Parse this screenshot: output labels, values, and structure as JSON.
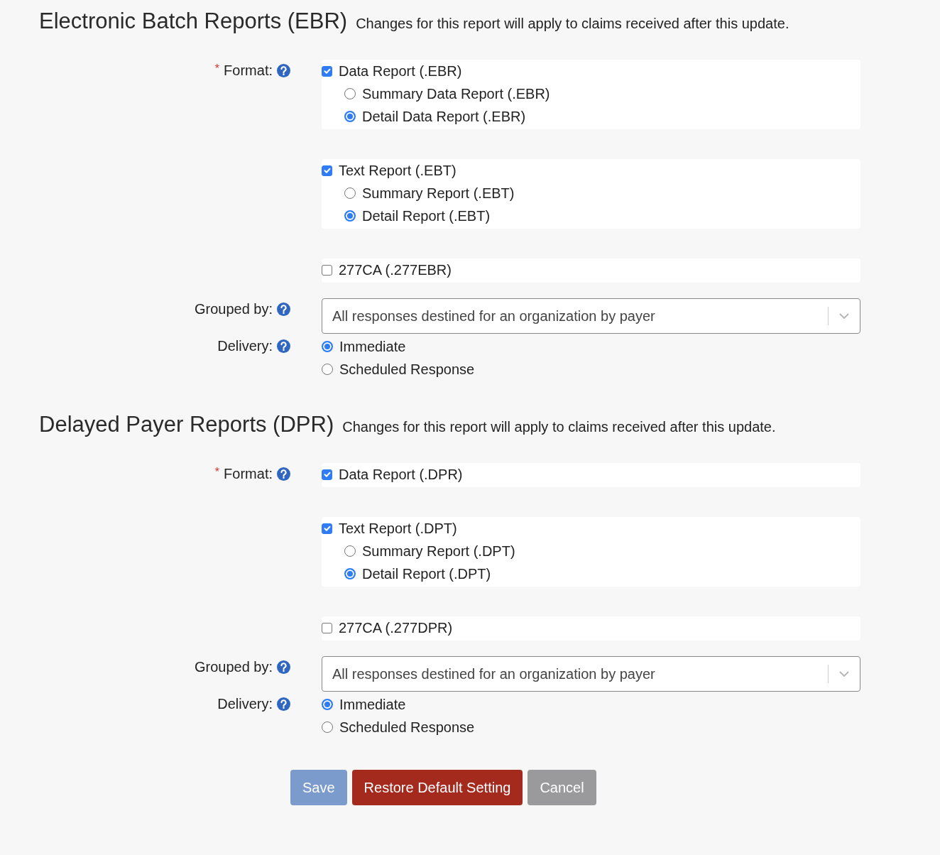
{
  "sections": [
    {
      "title": "Electronic Batch Reports (EBR)",
      "note": "Changes for this report will apply to claims received after this update.",
      "format": {
        "label": "Format:",
        "required_marker": "*",
        "options": [
          {
            "label": "Data Report (.EBR)",
            "checked": true,
            "suboptions": [
              {
                "label": "Summary Data Report (.EBR)",
                "selected": false
              },
              {
                "label": "Detail Data Report (.EBR)",
                "selected": true
              }
            ]
          },
          {
            "label": "Text Report (.EBT)",
            "checked": true,
            "suboptions": [
              {
                "label": "Summary Report (.EBT)",
                "selected": false
              },
              {
                "label": "Detail Report (.EBT)",
                "selected": true
              }
            ]
          },
          {
            "label": "277CA (.277EBR)",
            "checked": false
          }
        ]
      },
      "grouped_by": {
        "label": "Grouped by:",
        "value": "All responses destined for an organization by payer"
      },
      "delivery": {
        "label": "Delivery:",
        "options": [
          {
            "label": "Immediate",
            "selected": true
          },
          {
            "label": "Scheduled Response",
            "selected": false
          }
        ]
      }
    },
    {
      "title": "Delayed Payer Reports (DPR)",
      "note": "Changes for this report will apply to claims received after this update.",
      "format": {
        "label": "Format:",
        "required_marker": "*",
        "options": [
          {
            "label": "Data Report (.DPR)",
            "checked": true
          },
          {
            "label": "Text Report (.DPT)",
            "checked": true,
            "suboptions": [
              {
                "label": "Summary Report (.DPT)",
                "selected": false
              },
              {
                "label": "Detail Report (.DPT)",
                "selected": true
              }
            ]
          },
          {
            "label": "277CA (.277DPR)",
            "checked": false
          }
        ]
      },
      "grouped_by": {
        "label": "Grouped by:",
        "value": "All responses destined for an organization by payer"
      },
      "delivery": {
        "label": "Delivery:",
        "options": [
          {
            "label": "Immediate",
            "selected": true
          },
          {
            "label": "Scheduled Response",
            "selected": false
          }
        ]
      }
    }
  ],
  "buttons": [
    {
      "label": "Save",
      "kind": "primary",
      "disabled": true
    },
    {
      "label": "Restore Default Setting",
      "kind": "danger",
      "disabled": false
    },
    {
      "label": "Cancel",
      "kind": "secondary",
      "disabled": false
    }
  ]
}
